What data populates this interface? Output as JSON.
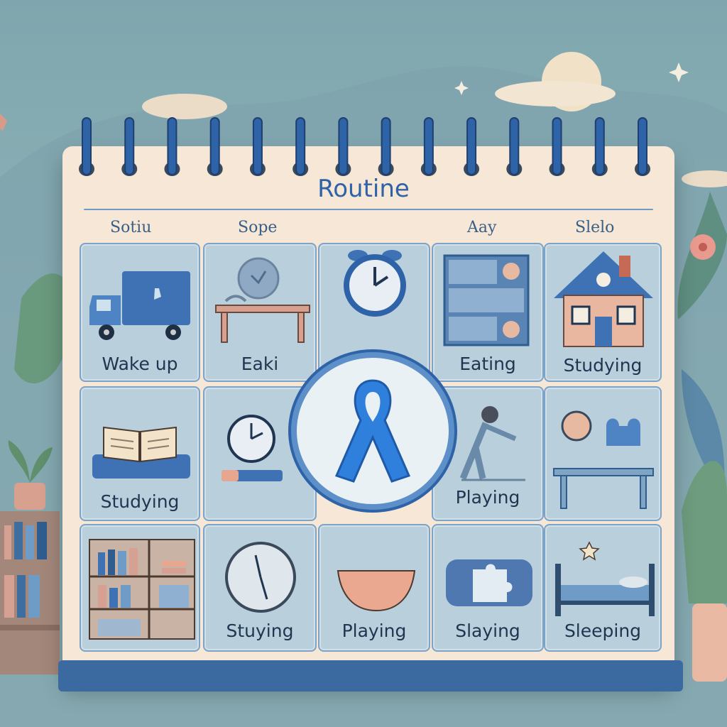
{
  "calendar": {
    "title": "Routine",
    "column_headers": [
      "Sotiu",
      "Sope",
      "Aay",
      "Slelo"
    ]
  },
  "cells": [
    {
      "label": "Wake up",
      "icon": "delivery-truck-icon"
    },
    {
      "label": "Eaki",
      "icon": "table-icon"
    },
    {
      "label": "",
      "icon": "alarm-clock-icon"
    },
    {
      "label": "Eating",
      "icon": "shelves-icon"
    },
    {
      "label": "Studying",
      "icon": "house-icon"
    },
    {
      "label": "Studying",
      "icon": "open-book-icon"
    },
    {
      "label": "",
      "icon": "clock-icon"
    },
    {
      "label": "Playing",
      "icon": "child-playing-icon"
    },
    {
      "label": "",
      "icon": "puzzle-table-icon"
    },
    {
      "label": "",
      "icon": "bookshelf-icon"
    },
    {
      "label": "Stuying",
      "icon": "wall-clock-icon"
    },
    {
      "label": "Playing",
      "icon": "bowl-icon"
    },
    {
      "label": "Slaying",
      "icon": "puzzle-pillow-icon"
    },
    {
      "label": "Sleeping",
      "icon": "bed-icon"
    }
  ],
  "center": {
    "icon": "awareness-ribbon-icon"
  },
  "colors": {
    "background": "#8fb3b8",
    "calendar_paper": "#f6e7d6",
    "accent_blue": "#2f63a8",
    "cell_fill": "#b9d0dc",
    "ribbon": "#2f80dd"
  }
}
